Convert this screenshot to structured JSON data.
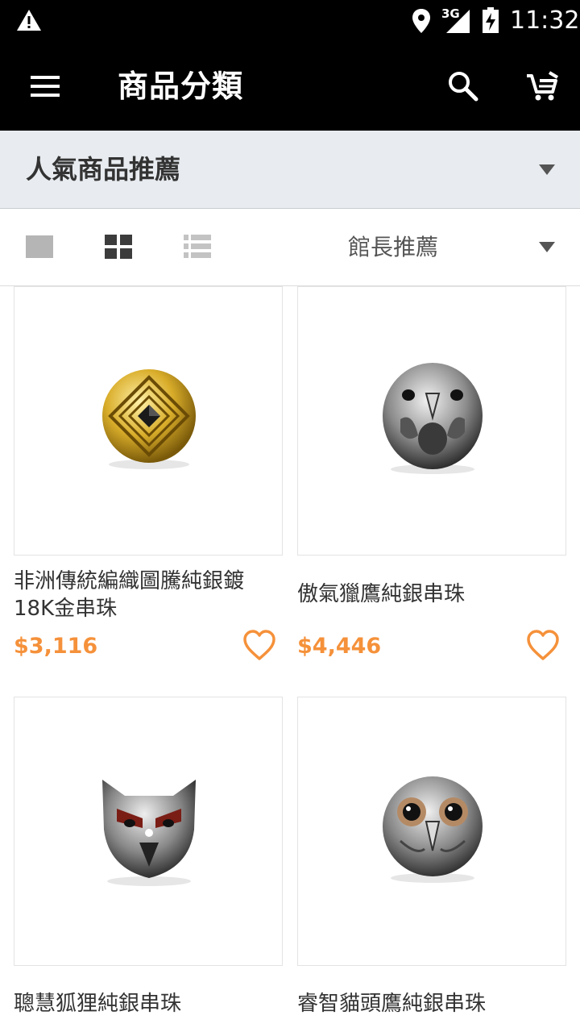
{
  "status_bar": {
    "time": "11:32",
    "network": "3G",
    "icons": [
      "warning-icon",
      "location-icon",
      "signal-icon",
      "battery-icon"
    ]
  },
  "app_bar": {
    "title": "商品分類",
    "icons": [
      "menu-icon",
      "search-icon",
      "cart-icon"
    ]
  },
  "category": {
    "selected": "人氣商品推薦"
  },
  "toolbar": {
    "view_modes": [
      "single-view-icon",
      "grid-view-icon",
      "list-view-icon"
    ],
    "sort": "館長推薦"
  },
  "products": [
    {
      "name": "非洲傳統編織圖騰純銀鍍18K金串珠",
      "price": "$3,116",
      "image": "gold-bead"
    },
    {
      "name": "傲氣獵鷹純銀串珠",
      "price": "$4,446",
      "image": "falcon-bead"
    },
    {
      "name": "聰慧狐狸純銀串珠",
      "price": "",
      "image": "fox-bead"
    },
    {
      "name": "睿智貓頭鷹純銀串珠",
      "price": "",
      "image": "owl-bead"
    }
  ],
  "colors": {
    "accent": "#f5913a",
    "app_bar": "#000000",
    "category_bar": "#e8ecf0"
  }
}
